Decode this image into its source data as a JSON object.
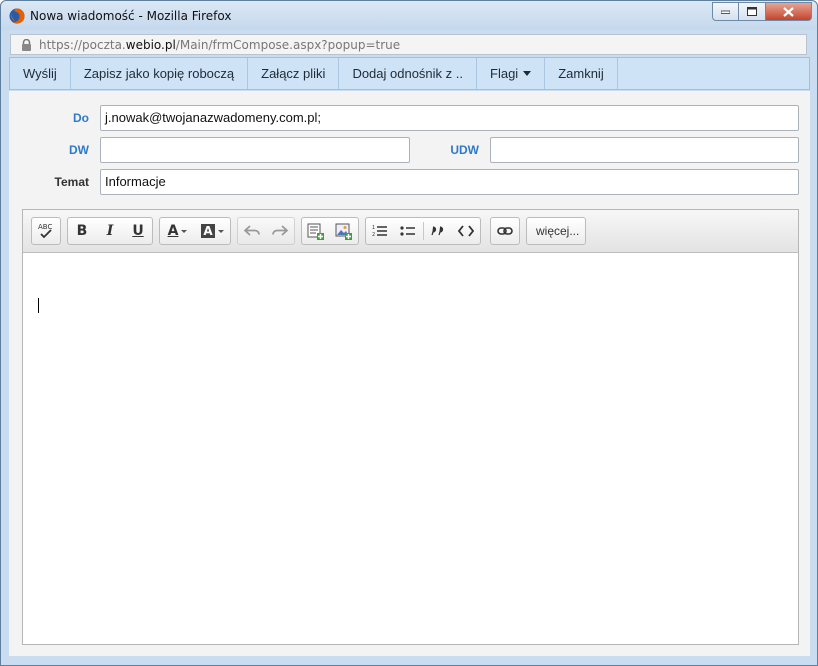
{
  "window": {
    "title": "Nowa wiadomość - Mozilla Firefox",
    "url_prefix": "https://poczta.",
    "url_domain": "webio.pl",
    "url_path": "/Main/frmCompose.aspx?popup=true"
  },
  "toolbar": {
    "send": "Wyślij",
    "save_draft": "Zapisz jako kopię roboczą",
    "attach": "Załącz pliki",
    "add_link": "Dodaj odnośnik z ..",
    "flags": "Flagi",
    "close": "Zamknij"
  },
  "form": {
    "to_label": "Do",
    "to_value": "j.nowak@twojanazwadomeny.com.pl;",
    "cc_label": "DW",
    "cc_value": "",
    "bcc_label": "UDW",
    "bcc_value": "",
    "subject_label": "Temat",
    "subject_value": "Informacje"
  },
  "editor": {
    "spellcheck_text": "ABC",
    "bold": "B",
    "italic": "I",
    "underline": "U",
    "font_color": "A",
    "bg_color": "A",
    "more_label": "więcej...",
    "icons": [
      "spellcheck-icon",
      "bold-icon",
      "italic-icon",
      "underline-icon",
      "font-color-icon",
      "background-color-icon",
      "undo-icon",
      "redo-icon",
      "insert-table-icon",
      "insert-image-icon",
      "ordered-list-icon",
      "bullet-list-icon",
      "blockquote-icon",
      "source-code-icon",
      "link-icon"
    ]
  },
  "colors": {
    "accent_label": "#2f7ac8",
    "toolbar_bg": "#cfe3f7",
    "window_frame": "#c9dcf0"
  }
}
